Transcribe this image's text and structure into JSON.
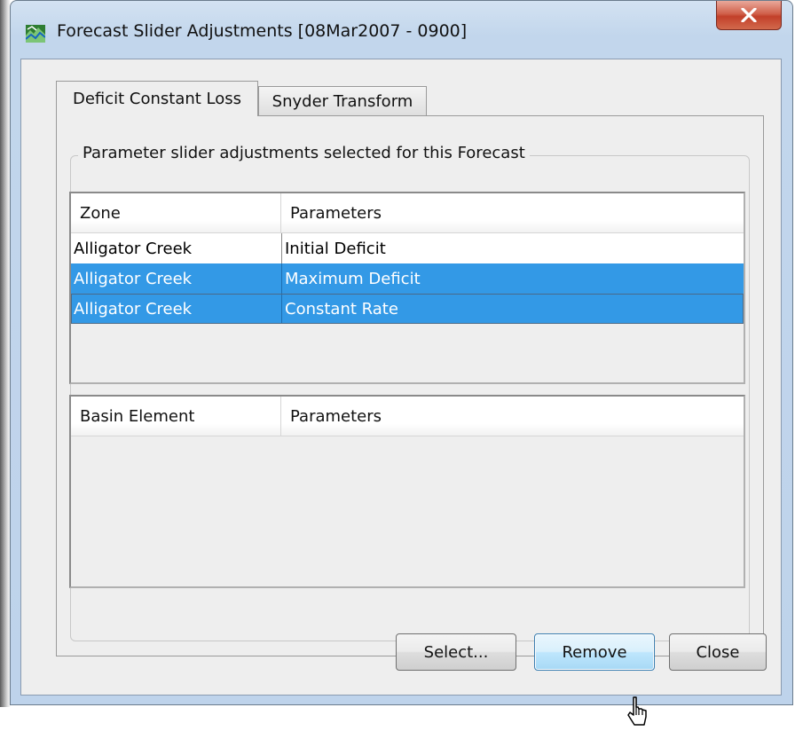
{
  "window": {
    "title": "Forecast Slider Adjustments [08Mar2007 - 0900]",
    "icon": "forecast-app-icon",
    "close_glyph": "X"
  },
  "tabs": [
    {
      "label": "Deficit Constant Loss",
      "active": true
    },
    {
      "label": "Snyder Transform",
      "active": false
    }
  ],
  "group": {
    "title": "Parameter slider adjustments selected for this Forecast"
  },
  "zone_table": {
    "headers": [
      "Zone",
      "Parameters"
    ],
    "rows": [
      {
        "zone": "Alligator Creek",
        "parameter": "Initial Deficit",
        "selected": false
      },
      {
        "zone": "Alligator Creek",
        "parameter": "Maximum Deficit",
        "selected": true
      },
      {
        "zone": "Alligator Creek",
        "parameter": "Constant Rate",
        "selected": true
      }
    ]
  },
  "basin_table": {
    "headers": [
      "Basin Element",
      "Parameters"
    ],
    "rows": []
  },
  "buttons": {
    "select": "Select...",
    "remove": "Remove",
    "close": "Close"
  },
  "colors": {
    "selection": "#3399e6",
    "titlebar": "#c2d6ec",
    "close_button": "#c2402a",
    "dialog_bg": "#eeeeee"
  }
}
